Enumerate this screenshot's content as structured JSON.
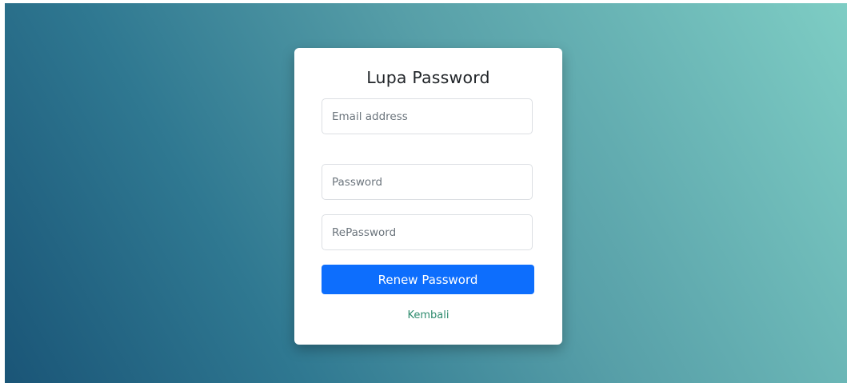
{
  "page": {
    "background_colors": [
      "#1a5577",
      "#2f7891",
      "#579fa8",
      "#7ecdc4"
    ]
  },
  "form": {
    "title": "Lupa Password",
    "email": {
      "placeholder": "Email address",
      "value": ""
    },
    "password": {
      "placeholder": "Password",
      "value": ""
    },
    "repassword": {
      "placeholder": "RePassword",
      "value": ""
    },
    "submit_label": "Renew Password",
    "back_link_label": "Kembali",
    "colors": {
      "button": "#0d6efd",
      "link": "#2e8b6e"
    }
  }
}
